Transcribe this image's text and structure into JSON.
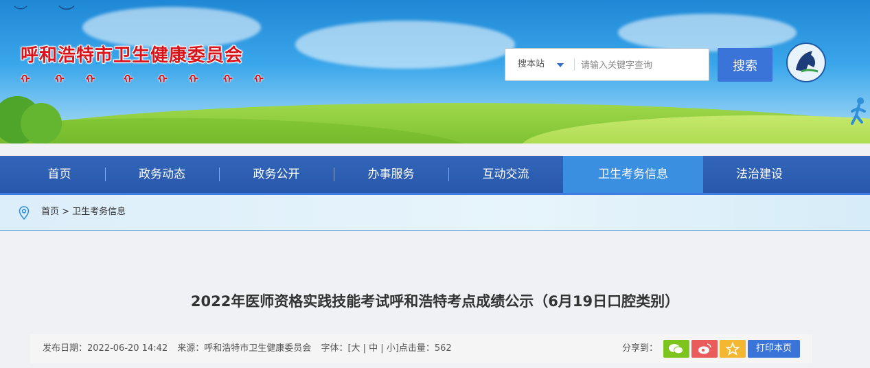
{
  "header": {
    "site_title": "呼和浩特市卫生健康委员会",
    "search": {
      "scope_label": "搜本站",
      "placeholder": "请输入关键字查询",
      "button_label": "搜索"
    }
  },
  "nav": {
    "items": [
      {
        "label": "首页"
      },
      {
        "label": "政务动态"
      },
      {
        "label": "政务公开"
      },
      {
        "label": "办事服务"
      },
      {
        "label": "互动交流"
      },
      {
        "label": "卫生考务信息"
      },
      {
        "label": "法治建设"
      }
    ],
    "active_index": 5
  },
  "breadcrumb": {
    "text": "首页 > 卫生考务信息"
  },
  "article": {
    "title": "2022年医师资格实践技能考试呼和浩特考点成绩公示（6月19日口腔类别）",
    "publish": "发布日期：2022-06-20 14:42",
    "source": "来源：呼和浩特市卫生健康委员会",
    "font_size": "字体：[大 | 中 | 小]点击量：562"
  },
  "share": {
    "label": "分享到：",
    "buttons": [
      {
        "name": "wechat",
        "color": "#7dc51d"
      },
      {
        "name": "weibo",
        "color": "#ea5b5b"
      },
      {
        "name": "favorite",
        "color": "#f3b731"
      }
    ],
    "print_label": "打印本页"
  },
  "colors": {
    "title_red": "#d9141b",
    "nav_blue": "#2f5fb3",
    "active_nav": "#3a8fe0",
    "button_blue": "#3b74d8"
  }
}
